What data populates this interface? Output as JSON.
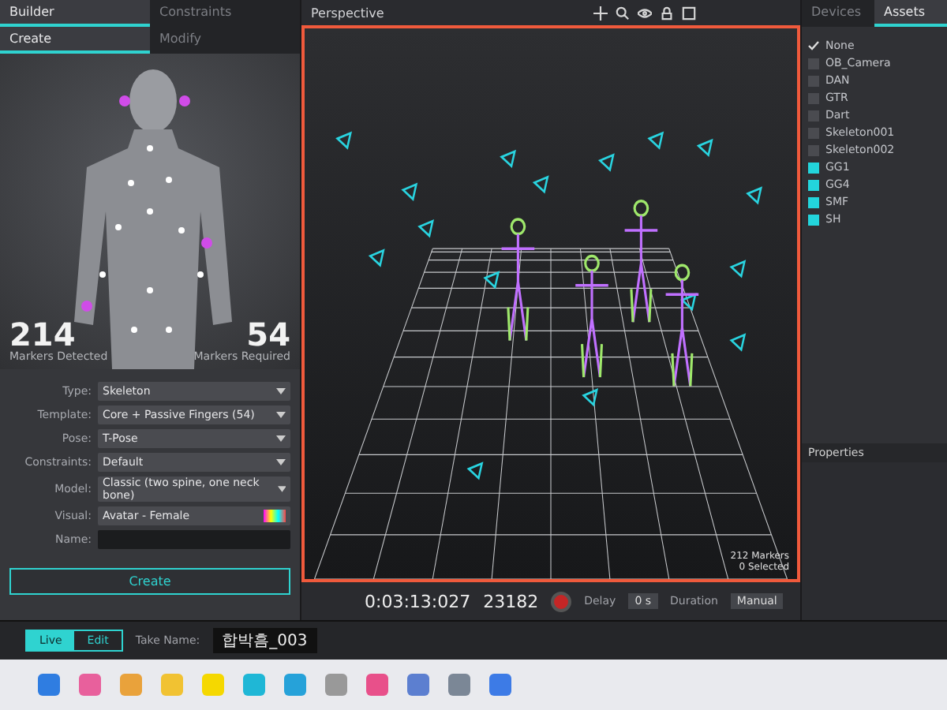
{
  "builder_panel": {
    "tabs": [
      {
        "label": "Builder",
        "selected": true
      },
      {
        "label": "Constraints",
        "selected": false
      }
    ],
    "mode_tabs": [
      {
        "label": "Create",
        "selected": true
      },
      {
        "label": "Modify",
        "selected": false
      }
    ],
    "markers_detected": {
      "value": "214",
      "label": "Markers Detected"
    },
    "markers_required": {
      "value": "54",
      "label": "Markers Required"
    },
    "fields": [
      {
        "label": "Type:",
        "value": "Skeleton",
        "kind": "dropdown"
      },
      {
        "label": "Template:",
        "value": "Core + Passive Fingers (54)",
        "kind": "dropdown"
      },
      {
        "label": "Pose:",
        "value": "T-Pose",
        "kind": "dropdown"
      },
      {
        "label": "Constraints:",
        "value": "Default",
        "kind": "dropdown"
      },
      {
        "label": "Model:",
        "value": "Classic (two spine, one neck bone)",
        "kind": "dropdown"
      },
      {
        "label": "Visual:",
        "value": "Avatar - Female",
        "kind": "swatch"
      },
      {
        "label": "Name:",
        "kind": "text"
      }
    ],
    "create_button": "Create"
  },
  "viewport": {
    "view_menu": "Perspective",
    "marker_count": "212 Markers",
    "selection_count": "0 Selected"
  },
  "timeline": {
    "time": "0:03:13:027",
    "frame": "23182",
    "recording": false,
    "delay_label": "Delay",
    "delay": "0 s",
    "duration_label": "Duration",
    "duration": "Manual"
  },
  "assets_panel": {
    "tabs": [
      {
        "label": "Devices",
        "selected": false
      },
      {
        "label": "Assets",
        "selected": true
      }
    ],
    "items": [
      {
        "label": "None",
        "kind": "option",
        "checked": true
      },
      {
        "label": "OB_Camera",
        "kind": "asset",
        "checked": false
      },
      {
        "label": "DAN",
        "kind": "asset",
        "checked": false
      },
      {
        "label": "GTR",
        "kind": "asset",
        "checked": false
      },
      {
        "label": "Dart",
        "kind": "asset",
        "checked": false
      },
      {
        "label": "Skeleton001",
        "kind": "asset",
        "checked": false
      },
      {
        "label": "Skeleton002",
        "kind": "asset",
        "checked": false
      },
      {
        "label": "GG1",
        "kind": "asset",
        "checked": true
      },
      {
        "label": "GG4",
        "kind": "asset",
        "checked": true
      },
      {
        "label": "SMF",
        "kind": "asset",
        "checked": true
      },
      {
        "label": "SH",
        "kind": "asset",
        "checked": true
      }
    ],
    "properties_title": "Properties"
  },
  "take_bar": {
    "modes": [
      {
        "label": "Live",
        "selected": true
      },
      {
        "label": "Edit",
        "selected": false
      }
    ],
    "take_label": "Take Name:",
    "take_name": "합박흠_003"
  }
}
